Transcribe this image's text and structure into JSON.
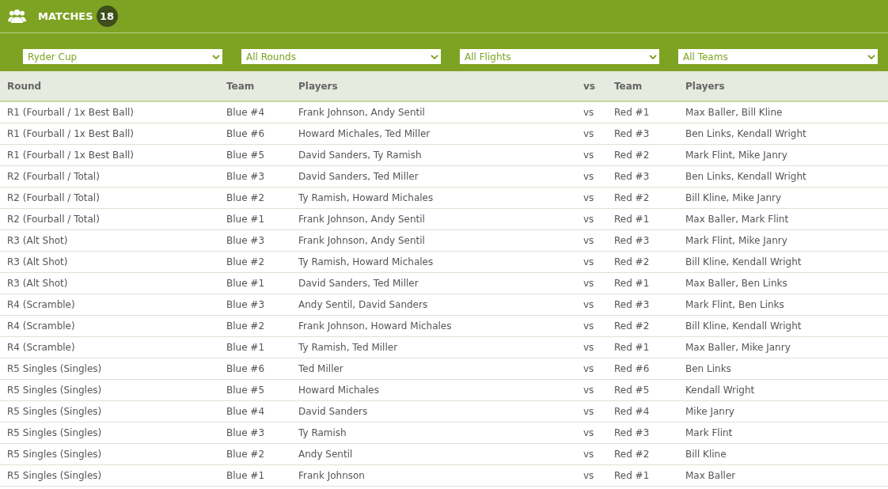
{
  "header": {
    "title": "MATCHES",
    "count": "18"
  },
  "filters": [
    {
      "value": "Ryder Cup"
    },
    {
      "value": "All Rounds"
    },
    {
      "value": "All Flights"
    },
    {
      "value": "All Teams"
    }
  ],
  "table": {
    "columns": [
      "Round",
      "Team",
      "Players",
      "vs",
      "Team",
      "Players"
    ],
    "rows": [
      [
        "R1 (Fourball / 1x Best Ball)",
        "Blue #4",
        "Frank Johnson, Andy Sentil",
        "vs",
        "Red #1",
        "Max Baller, Bill Kline"
      ],
      [
        "R1 (Fourball / 1x Best Ball)",
        "Blue #6",
        "Howard Michales, Ted Miller",
        "vs",
        "Red #3",
        "Ben Links, Kendall Wright"
      ],
      [
        "R1 (Fourball / 1x Best Ball)",
        "Blue #5",
        "David Sanders, Ty Ramish",
        "vs",
        "Red #2",
        "Mark Flint, Mike Janry"
      ],
      [
        "R2 (Fourball / Total)",
        "Blue #3",
        "David Sanders, Ted Miller",
        "vs",
        "Red #3",
        "Ben Links, Kendall Wright"
      ],
      [
        "R2 (Fourball / Total)",
        "Blue #2",
        "Ty Ramish, Howard Michales",
        "vs",
        "Red #2",
        "Bill Kline, Mike Janry"
      ],
      [
        "R2 (Fourball / Total)",
        "Blue #1",
        "Frank Johnson, Andy Sentil",
        "vs",
        "Red #1",
        "Max Baller, Mark Flint"
      ],
      [
        "R3 (Alt Shot)",
        "Blue #3",
        "Frank Johnson, Andy Sentil",
        "vs",
        "Red #3",
        "Mark Flint, Mike Janry"
      ],
      [
        "R3 (Alt Shot)",
        "Blue #2",
        "Ty Ramish, Howard Michales",
        "vs",
        "Red #2",
        "Bill Kline, Kendall Wright"
      ],
      [
        "R3 (Alt Shot)",
        "Blue #1",
        "David Sanders, Ted Miller",
        "vs",
        "Red #1",
        "Max Baller, Ben Links"
      ],
      [
        "R4 (Scramble)",
        "Blue #3",
        "Andy Sentil, David Sanders",
        "vs",
        "Red #3",
        "Mark Flint, Ben Links"
      ],
      [
        "R4 (Scramble)",
        "Blue #2",
        "Frank Johnson, Howard Michales",
        "vs",
        "Red #2",
        "Bill Kline, Kendall Wright"
      ],
      [
        "R4 (Scramble)",
        "Blue #1",
        "Ty Ramish, Ted Miller",
        "vs",
        "Red #1",
        "Max Baller, Mike Janry"
      ],
      [
        "R5 Singles (Singles)",
        "Blue #6",
        "Ted Miller",
        "vs",
        "Red #6",
        "Ben Links"
      ],
      [
        "R5 Singles (Singles)",
        "Blue #5",
        "Howard Michales",
        "vs",
        "Red #5",
        "Kendall Wright"
      ],
      [
        "R5 Singles (Singles)",
        "Blue #4",
        "David Sanders",
        "vs",
        "Red #4",
        "Mike Janry"
      ],
      [
        "R5 Singles (Singles)",
        "Blue #3",
        "Ty Ramish",
        "vs",
        "Red #3",
        "Mark Flint"
      ],
      [
        "R5 Singles (Singles)",
        "Blue #2",
        "Andy Sentil",
        "vs",
        "Red #2",
        "Bill Kline"
      ],
      [
        "R5 Singles (Singles)",
        "Blue #1",
        "Frank Johnson",
        "vs",
        "Red #1",
        "Max Baller"
      ]
    ]
  }
}
